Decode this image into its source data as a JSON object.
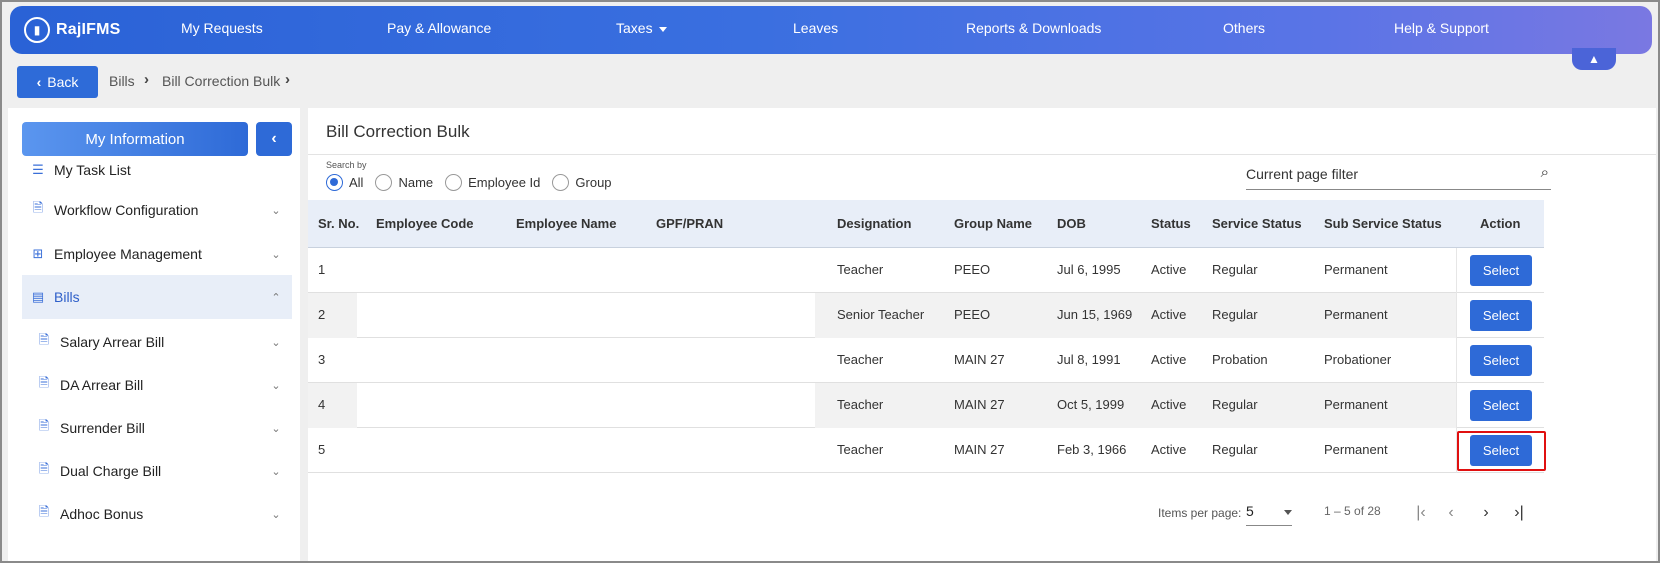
{
  "topnav": {
    "logo_text": "RajIFMS",
    "items": [
      {
        "label": "My Requests"
      },
      {
        "label": "Pay & Allowance"
      },
      {
        "label": "Taxes"
      },
      {
        "label": "Leaves"
      },
      {
        "label": "Reports & Downloads"
      },
      {
        "label": "Others"
      },
      {
        "label": "Help & Support"
      }
    ]
  },
  "breadcrumb": {
    "back_label": "Back",
    "items": [
      "Bills",
      "Bill Correction Bulk"
    ]
  },
  "sidebar": {
    "header_button": "My Information",
    "items": [
      {
        "label": "My Task List",
        "icon": "list-icon",
        "has_chevron": false
      },
      {
        "label": "Workflow Configuration",
        "icon": "document-search-icon",
        "has_chevron": true
      },
      {
        "label": "Employee Management",
        "icon": "briefcase-icon",
        "has_chevron": true
      },
      {
        "label": "Bills",
        "icon": "receipt-icon",
        "has_chevron": true,
        "expanded": true
      },
      {
        "label": "Salary Arrear Bill",
        "icon": "document-search-icon",
        "has_chevron": true
      },
      {
        "label": "DA Arrear Bill",
        "icon": "document-search-icon",
        "has_chevron": true
      },
      {
        "label": "Surrender Bill",
        "icon": "document-search-icon",
        "has_chevron": true
      },
      {
        "label": "Dual Charge Bill",
        "icon": "document-search-icon",
        "has_chevron": true
      },
      {
        "label": "Adhoc Bonus",
        "icon": "document-search-icon",
        "has_chevron": true
      }
    ]
  },
  "main": {
    "title": "Bill Correction Bulk",
    "search_by_label": "Search by",
    "radio_options": [
      {
        "label": "All",
        "checked": true
      },
      {
        "label": "Name",
        "checked": false
      },
      {
        "label": "Employee Id",
        "checked": false
      },
      {
        "label": "Group",
        "checked": false
      }
    ],
    "filter_placeholder": "Current page filter",
    "table": {
      "columns": [
        "Sr. No.",
        "Employee Code",
        "Employee Name",
        "GPF/PRAN",
        "Designation",
        "Group Name",
        "DOB",
        "Status",
        "Service Status",
        "Sub Service Status",
        "Action"
      ],
      "rows": [
        {
          "sr": "1",
          "code": "",
          "name": "",
          "gpf": "",
          "designation": "Teacher",
          "group": "PEEO",
          "dob": "Jul 6, 1995",
          "status": "Active",
          "service_status": "Regular",
          "sub_service_status": "Permanent",
          "action": "Select"
        },
        {
          "sr": "2",
          "code": "",
          "name": "",
          "gpf": "",
          "designation": "Senior Teacher",
          "group": "PEEO",
          "dob": "Jun 15, 1969",
          "status": "Active",
          "service_status": "Regular",
          "sub_service_status": "Permanent",
          "action": "Select"
        },
        {
          "sr": "3",
          "code": "",
          "name": "",
          "gpf": "",
          "designation": "Teacher",
          "group": "MAIN 27",
          "dob": "Jul 8, 1991",
          "status": "Active",
          "service_status": "Probation",
          "sub_service_status": "Probationer",
          "action": "Select"
        },
        {
          "sr": "4",
          "code": "",
          "name": "",
          "gpf": "",
          "designation": "Teacher",
          "group": "MAIN 27",
          "dob": "Oct 5, 1999",
          "status": "Active",
          "service_status": "Regular",
          "sub_service_status": "Permanent",
          "action": "Select"
        },
        {
          "sr": "5",
          "code": "",
          "name": "",
          "gpf": "",
          "designation": "Teacher",
          "group": "MAIN 27",
          "dob": "Feb 3, 1966",
          "status": "Active",
          "service_status": "Regular",
          "sub_service_status": "Permanent",
          "action": "Select"
        }
      ]
    },
    "paginator": {
      "items_per_page_label": "Items per page:",
      "items_per_page_value": "5",
      "range_label": "1 – 5 of 28"
    }
  },
  "colors": {
    "primary": "#2e6ad7",
    "nav_gradient_start": "#2a62d6",
    "nav_gradient_end": "#7a78e2",
    "highlight": "#e01010"
  }
}
